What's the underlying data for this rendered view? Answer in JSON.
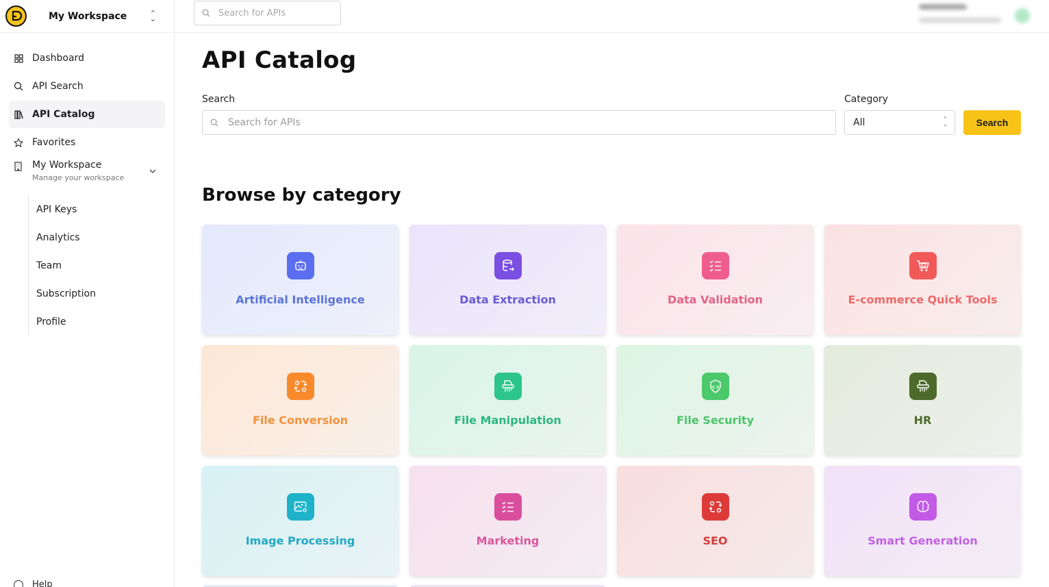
{
  "workspace_switcher": {
    "name": "My Workspace"
  },
  "top_search": {
    "placeholder": "Search for APIs"
  },
  "sidebar": {
    "items": [
      {
        "label": "Dashboard",
        "icon": "dashboard-grid-icon"
      },
      {
        "label": "API Search",
        "icon": "search-icon"
      },
      {
        "label": "API Catalog",
        "icon": "catalog-icon",
        "active": true
      },
      {
        "label": "Favorites",
        "icon": "star-icon"
      }
    ],
    "workspace": {
      "label": "My Workspace",
      "sublabel": "Manage your workspace",
      "icon": "building-icon"
    },
    "subitems": [
      {
        "label": "API Keys"
      },
      {
        "label": "Analytics"
      },
      {
        "label": "Team"
      },
      {
        "label": "Subscription"
      },
      {
        "label": "Profile"
      }
    ],
    "help": "Help"
  },
  "main": {
    "title": "API Catalog",
    "search_label": "Search",
    "search_placeholder": "Search for APIs",
    "category_label": "Category",
    "category_value": "All",
    "search_button": "Search",
    "browse_title": "Browse by category"
  },
  "categories": [
    {
      "name": "Artificial Intelligence",
      "icon": "robot-icon",
      "color": "#5b6ef0",
      "text": "#5a74d6"
    },
    {
      "name": "Data Extraction",
      "icon": "database-export-icon",
      "color": "#7a4fe2",
      "text": "#6a5bd0"
    },
    {
      "name": "Data Validation",
      "icon": "checklist-icon",
      "color": "#ef5d8e",
      "text": "#e46389"
    },
    {
      "name": "E-commerce Quick Tools",
      "icon": "shopping-cart-icon",
      "color": "#f25a5a",
      "text": "#ec6a6a"
    },
    {
      "name": "File Conversion",
      "icon": "convert-icon",
      "color": "#f98a2c",
      "text": "#f3923c"
    },
    {
      "name": "File Manipulation",
      "icon": "file-shred-icon",
      "color": "#2cc58a",
      "text": "#2cb77f"
    },
    {
      "name": "File Security",
      "icon": "shield-code-icon",
      "color": "#4cc96b",
      "text": "#4cc46a"
    },
    {
      "name": "HR",
      "icon": "file-shred-icon",
      "color": "#4d6a2a",
      "text": "#4d6a2a"
    },
    {
      "name": "Image Processing",
      "icon": "image-gear-icon",
      "color": "#1fb3c9",
      "text": "#22a9c4"
    },
    {
      "name": "Marketing",
      "icon": "checklist-icon",
      "color": "#d94f9e",
      "text": "#d8589e"
    },
    {
      "name": "SEO",
      "icon": "convert-icon",
      "color": "#dd3a3a",
      "text": "#d43c3c"
    },
    {
      "name": "Smart Generation",
      "icon": "brain-icon",
      "color": "#c25ae6",
      "text": "#c061e0"
    }
  ]
}
